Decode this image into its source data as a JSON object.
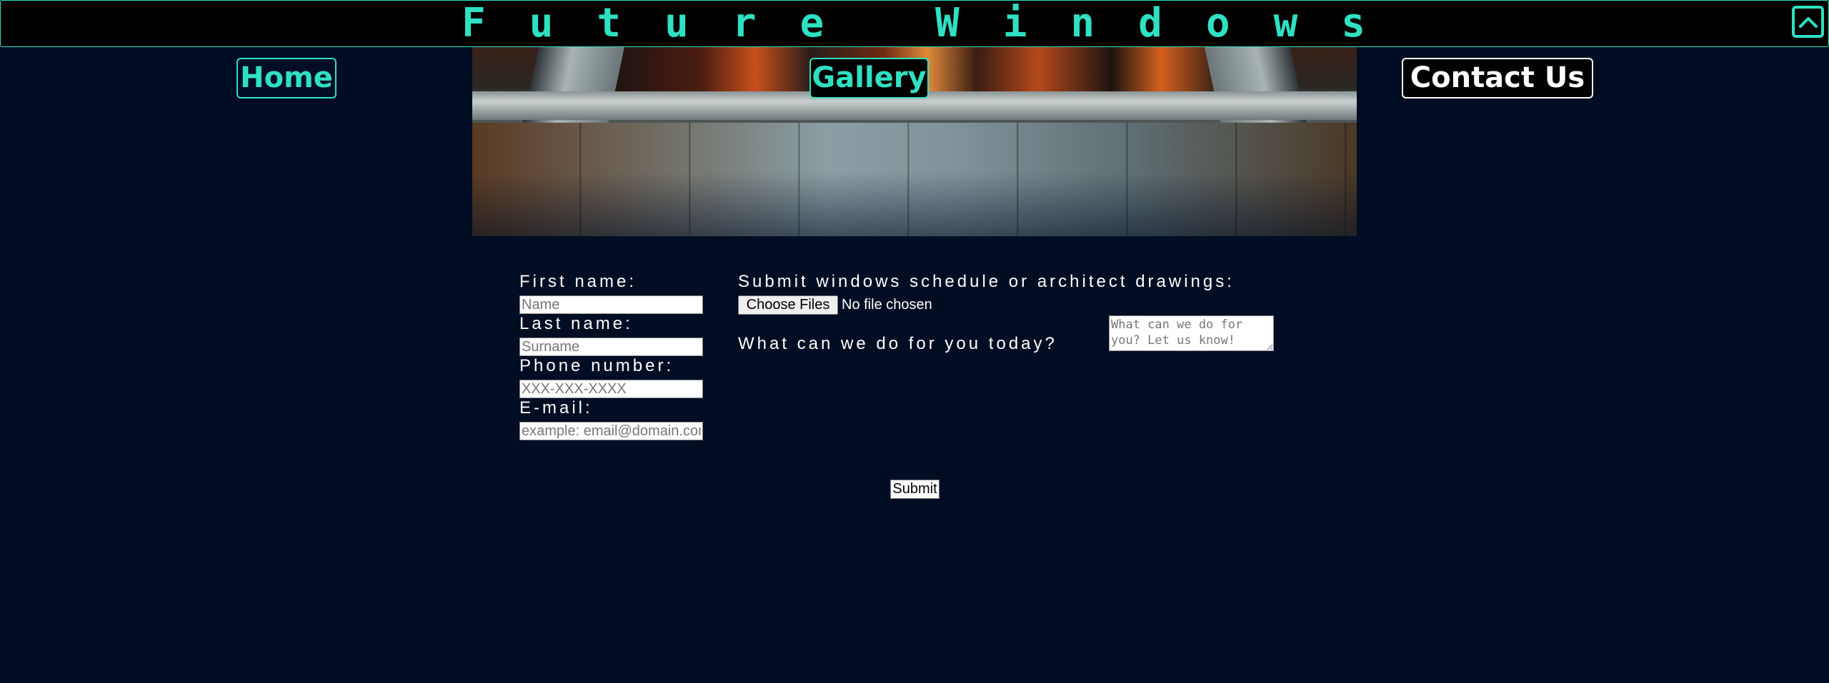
{
  "header": {
    "title": "Future Windows",
    "back_to_top_icon": "chevron-up-icon"
  },
  "nav": {
    "home": "Home",
    "gallery": "Gallery",
    "contact": "Contact Us"
  },
  "hero": {
    "image": "window-city-view"
  },
  "form": {
    "first_name_label": "First name:",
    "first_name_placeholder": "Name",
    "last_name_label": "Last name:",
    "last_name_placeholder": "Surname",
    "phone_label": "Phone number:",
    "phone_placeholder": "XXX-XXX-XXXX",
    "email_label": "E-mail:",
    "email_placeholder": "example: email@domain.com",
    "upload_label": "Submit windows schedule or architect drawings:",
    "file_button": "Choose Files",
    "file_status": "No file chosen",
    "message_label": "What can we do for you today?",
    "message_placeholder": "What can we do for you? Let us know!",
    "submit": "Submit"
  },
  "colors": {
    "background": "#000d22",
    "accent": "#2fe0c2",
    "header_bg": "#000000"
  }
}
